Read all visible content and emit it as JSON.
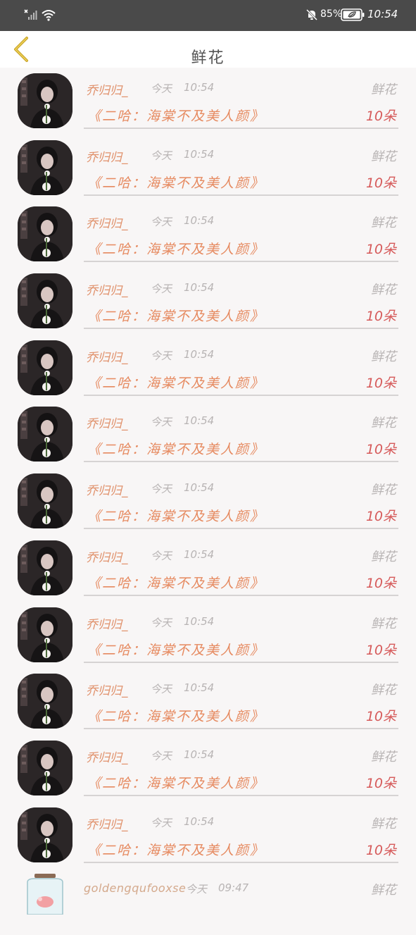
{
  "status_bar": {
    "battery_percent": "85%",
    "time": "10:54"
  },
  "header": {
    "title": "鲜花",
    "back_icon": "chevron-left-icon"
  },
  "rows": [
    {
      "user": "乔归归_",
      "day": "今天",
      "time": "10:54",
      "type": "鲜花",
      "book": "《二哈：海棠不及美人颜》",
      "count": "10朵"
    },
    {
      "user": "乔归归_",
      "day": "今天",
      "time": "10:54",
      "type": "鲜花",
      "book": "《二哈：海棠不及美人颜》",
      "count": "10朵"
    },
    {
      "user": "乔归归_",
      "day": "今天",
      "time": "10:54",
      "type": "鲜花",
      "book": "《二哈：海棠不及美人颜》",
      "count": "10朵"
    },
    {
      "user": "乔归归_",
      "day": "今天",
      "time": "10:54",
      "type": "鲜花",
      "book": "《二哈：海棠不及美人颜》",
      "count": "10朵"
    },
    {
      "user": "乔归归_",
      "day": "今天",
      "time": "10:54",
      "type": "鲜花",
      "book": "《二哈：海棠不及美人颜》",
      "count": "10朵"
    },
    {
      "user": "乔归归_",
      "day": "今天",
      "time": "10:54",
      "type": "鲜花",
      "book": "《二哈：海棠不及美人颜》",
      "count": "10朵"
    },
    {
      "user": "乔归归_",
      "day": "今天",
      "time": "10:54",
      "type": "鲜花",
      "book": "《二哈：海棠不及美人颜》",
      "count": "10朵"
    },
    {
      "user": "乔归归_",
      "day": "今天",
      "time": "10:54",
      "type": "鲜花",
      "book": "《二哈：海棠不及美人颜》",
      "count": "10朵"
    },
    {
      "user": "乔归归_",
      "day": "今天",
      "time": "10:54",
      "type": "鲜花",
      "book": "《二哈：海棠不及美人颜》",
      "count": "10朵"
    },
    {
      "user": "乔归归_",
      "day": "今天",
      "time": "10:54",
      "type": "鲜花",
      "book": "《二哈：海棠不及美人颜》",
      "count": "10朵"
    },
    {
      "user": "乔归归_",
      "day": "今天",
      "time": "10:54",
      "type": "鲜花",
      "book": "《二哈：海棠不及美人颜》",
      "count": "10朵"
    },
    {
      "user": "乔归归_",
      "day": "今天",
      "time": "10:54",
      "type": "鲜花",
      "book": "《二哈：海棠不及美人颜》",
      "count": "10朵"
    }
  ],
  "last_row": {
    "user": "goldengqufooxse",
    "day": "今天",
    "time": "09:47",
    "type": "鲜花"
  },
  "colors": {
    "status_bar_bg": "#4a4a4a",
    "username": "#e0906a",
    "book_title": "#e68a60",
    "count": "#d65a5a",
    "muted": "#b8b4b4"
  }
}
